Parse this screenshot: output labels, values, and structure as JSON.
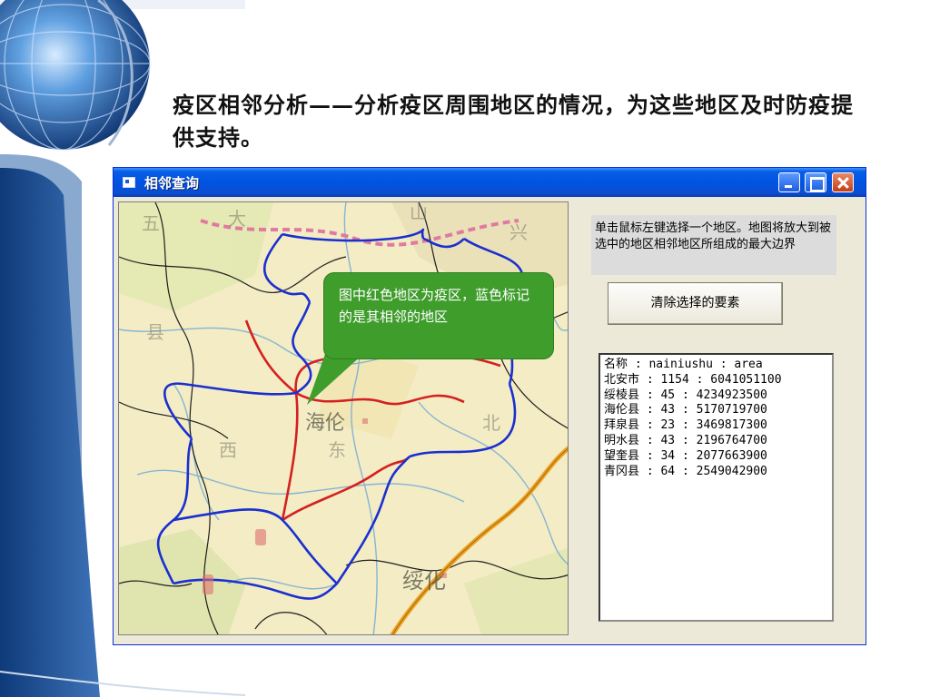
{
  "slide": {
    "title": "疫区相邻分析——分析疫区周围地区的情况，为这些地区及时防疫提供支持。"
  },
  "window": {
    "title": "相邻查询",
    "controls": [
      "minimize",
      "maximize",
      "close"
    ]
  },
  "callout": {
    "text": "图中红色地区为疫区，蓝色标记的是其相邻的地区"
  },
  "hint": {
    "text": "单击鼠标左键选择一个地区。地图将放大到被选中的地区相邻地区所组成的最大边界"
  },
  "buttons": {
    "clear_label": "清除选择的要素"
  },
  "list": {
    "items": [
      "名称 : nainiushu : area",
      "北安市 : 1154 : 6041051100",
      "绥棱县 : 45 : 4234923500",
      "海伦县 : 43 : 5170719700",
      "拜泉县 : 23 : 3469817300",
      "明水县 : 43 : 2196764700",
      "望奎县 : 34 : 2077663900",
      "青冈县 : 64 : 2549042900"
    ]
  },
  "map": {
    "labels": [
      "海伦",
      "绥化"
    ]
  },
  "colors": {
    "title_bar": "#0054e3",
    "window_bg": "#ece9d8",
    "epidemic_region": "#d42020",
    "adjacent_region": "#1a2fd0",
    "callout": "#3f9d2c"
  }
}
